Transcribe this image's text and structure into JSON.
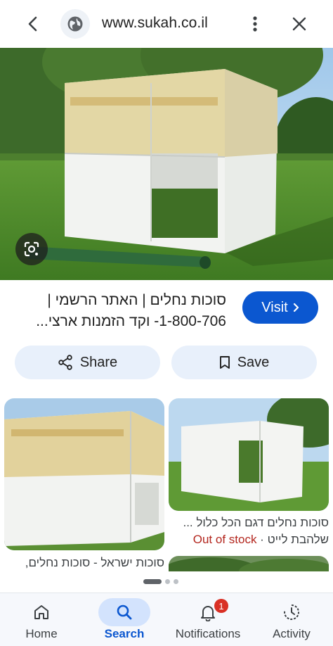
{
  "browser": {
    "url": "www.sukah.co.il"
  },
  "result": {
    "title_line1": "סוכות נחלים | האתר הרשמי |",
    "title_line2": "1-800-706- וקד הזמנות ארצי...",
    "visit_label": "Visit",
    "share_label": "Share",
    "save_label": "Save"
  },
  "related": [
    {
      "caption": "סוכות ישראל - סוכות נחלים,"
    },
    {
      "caption": "סוכות נחלים דגם הכל כלול ...",
      "merchant": "שלהבת לייט",
      "separator": " · ",
      "stock": "Out of stock"
    },
    {
      "caption": ""
    }
  ],
  "bottom_nav": {
    "home": "Home",
    "search": "Search",
    "notifications": "Notifications",
    "notifications_badge": "1",
    "activity": "Activity"
  },
  "colors": {
    "accent": "#0b57d0",
    "pill_bg": "#e8f0fb",
    "out_of_stock": "#b3261e",
    "badge": "#d93025"
  }
}
